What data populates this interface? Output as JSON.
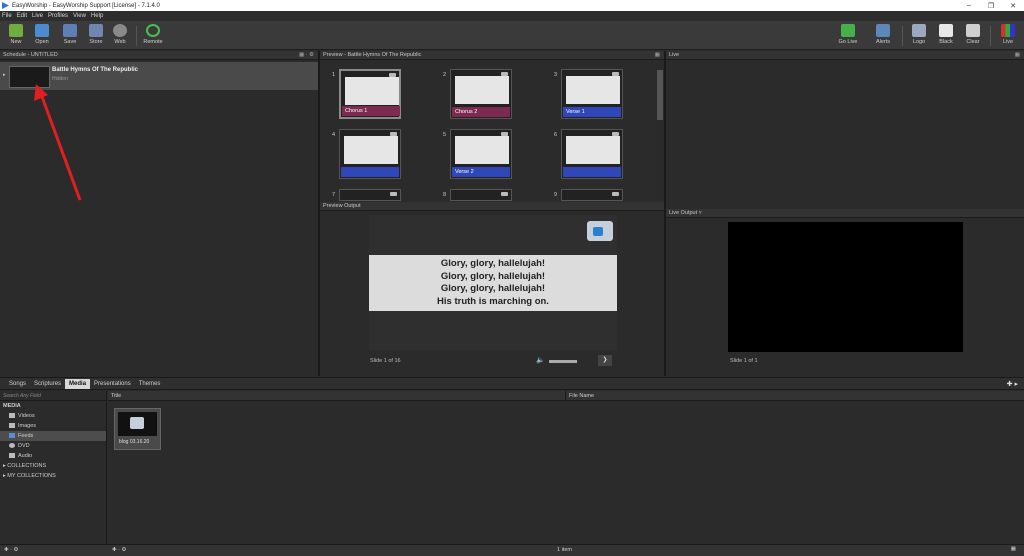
{
  "window": {
    "title": "EasyWorship - EasyWorship Support [License] - 7.1.4.0"
  },
  "menu": [
    "File",
    "Edit",
    "Live",
    "Profiles",
    "View",
    "Help"
  ],
  "toolbar": {
    "new": "New",
    "open": "Open",
    "save": "Save",
    "store": "Store",
    "web": "Web",
    "remote": "Remote",
    "go_live": "Go Live",
    "alerts": "Alerts",
    "logo": "Logo",
    "black": "Black",
    "clear": "Clear",
    "live": "Live"
  },
  "schedule": {
    "header": "Schedule - UNTITLED",
    "item_title": "Battle Hymns Of The Republic",
    "item_sub": "Hidden"
  },
  "preview": {
    "header": "Preview - Battle Hymns Of The Republic",
    "slides": [
      {
        "num": "1",
        "label": "Chorus 1",
        "color": "#7c2a4f"
      },
      {
        "num": "2",
        "label": "Chorus 2",
        "color": "#7c2a4f"
      },
      {
        "num": "3",
        "label": "Verse 1",
        "color": "#2f47b8"
      },
      {
        "num": "4",
        "label": "",
        "color": "#2f47b8"
      },
      {
        "num": "5",
        "label": "Verse 2",
        "color": "#2f47b8"
      },
      {
        "num": "6",
        "label": "",
        "color": "#2f47b8"
      },
      {
        "num": "7",
        "label": "",
        "color": "#2f47b8"
      },
      {
        "num": "8",
        "label": "",
        "color": "#2f47b8"
      },
      {
        "num": "9",
        "label": "",
        "color": "#2f47b8"
      }
    ]
  },
  "live": {
    "header": "Live"
  },
  "preview_output": {
    "header": "Preview Output",
    "lines": [
      "Glory, glory, hallelujah!",
      "Glory, glory, hallelujah!",
      "Glory, glory, hallelujah!",
      "His truth is marching on."
    ],
    "slide_count": "Slide 1 of 16"
  },
  "live_output": {
    "header": "Live Output ˅",
    "slide_count": "Slide 1 of 1"
  },
  "library": {
    "tabs": [
      "Songs",
      "Scriptures",
      "Media",
      "Presentations",
      "Themes"
    ],
    "active_tab": "Media",
    "search_placeholder": "Search Any Field",
    "col_title": "Title",
    "col_filename": "File Name",
    "tree": {
      "root": "MEDIA",
      "items": [
        "Videos",
        "Images",
        "Feeds",
        "DVD",
        "Audio"
      ],
      "collections": "COLLECTIONS",
      "my_collections": "MY COLLECTIONS"
    },
    "media_item": "blog 03.16.20",
    "status": "1 item"
  }
}
